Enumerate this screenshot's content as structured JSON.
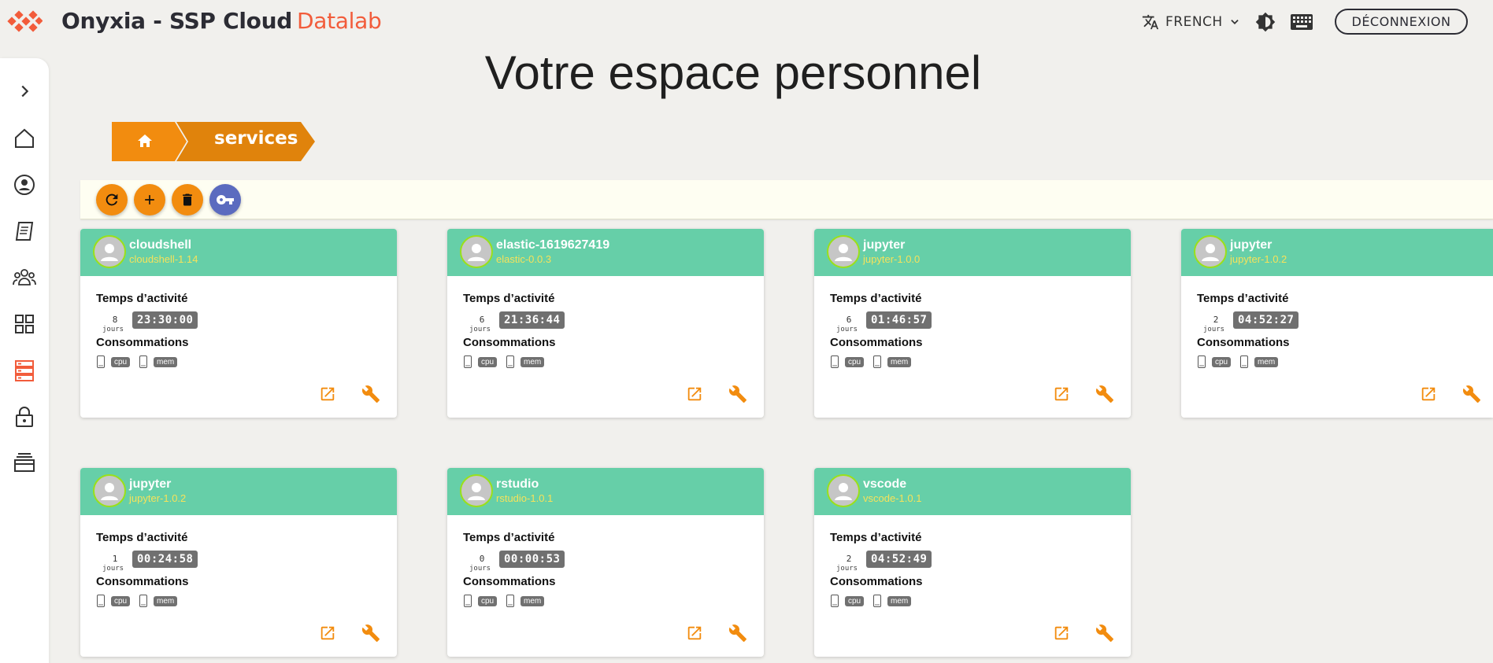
{
  "header": {
    "brand": "Onyxia - SSP Cloud",
    "brand_accent": "Datalab",
    "language": "FRENCH",
    "logout_label": "DÉCONNEXION"
  },
  "sidebar": {
    "items": [
      {
        "icon": "chevron-right-icon"
      },
      {
        "icon": "home-icon"
      },
      {
        "icon": "account-icon"
      },
      {
        "icon": "trainings-icon"
      },
      {
        "icon": "community-icon"
      },
      {
        "icon": "catalog-icon"
      },
      {
        "icon": "services-icon",
        "active": true
      },
      {
        "icon": "secrets-icon"
      },
      {
        "icon": "storage-icon"
      }
    ]
  },
  "page": {
    "title": "Votre espace personnel",
    "breadcrumb": "services"
  },
  "toolbar": {
    "buttons": [
      {
        "icon": "refresh-icon",
        "color": "#f28c0f"
      },
      {
        "icon": "add-icon",
        "color": "#f28c0f"
      },
      {
        "icon": "delete-icon",
        "color": "#f28c0f"
      },
      {
        "icon": "key-icon",
        "color": "#5b6bbf"
      }
    ]
  },
  "labels": {
    "uptime": "Temps d’activité",
    "consumption": "Consommations",
    "days": "jours",
    "cpu": "cpu",
    "mem": "mem"
  },
  "services": [
    {
      "name": "cloudshell",
      "version": "cloudshell-1.14",
      "days": "8",
      "time": "23:30:00"
    },
    {
      "name": "elastic-1619627419",
      "version": "elastic-0.0.3",
      "days": "6",
      "time": "21:36:44"
    },
    {
      "name": "jupyter",
      "version": "jupyter-1.0.0",
      "days": "6",
      "time": "01:46:57"
    },
    {
      "name": "jupyter",
      "version": "jupyter-1.0.2",
      "days": "2",
      "time": "04:52:27"
    },
    {
      "name": "jupyter",
      "version": "jupyter-1.0.2",
      "days": "1",
      "time": "00:24:58"
    },
    {
      "name": "rstudio",
      "version": "rstudio-1.0.1",
      "days": "0",
      "time": "00:00:53"
    },
    {
      "name": "vscode",
      "version": "vscode-1.0.1",
      "days": "2",
      "time": "04:52:49"
    }
  ],
  "colors": {
    "accent": "#f28c0f",
    "card_header": "#66cfa8",
    "version_text": "#f6e25a",
    "brand_accent": "#f25c3b",
    "key_button": "#5b6bbf"
  }
}
